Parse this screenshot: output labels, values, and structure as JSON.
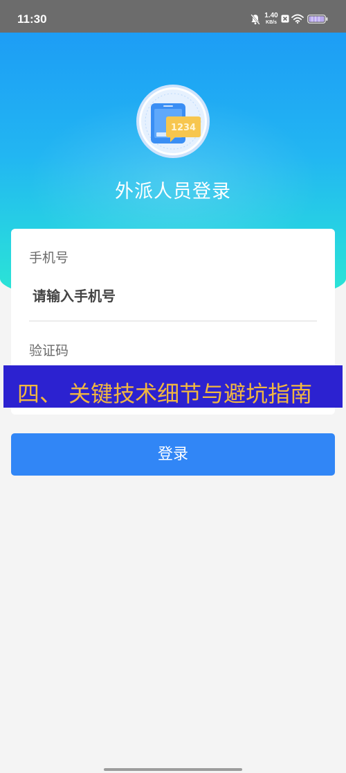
{
  "status_bar": {
    "time": "11:30",
    "network_speed_value": "1.40",
    "network_speed_unit": "KB/s",
    "icons": {
      "notifications": "bell-muted-icon",
      "sim": "sim-off-icon",
      "wifi": "wifi-icon",
      "battery": "battery-icon"
    }
  },
  "header": {
    "title": "外派人员登录",
    "logo_code": "1234",
    "logo_icon": "phone-verification-code-icon"
  },
  "form": {
    "phone": {
      "label": "手机号",
      "placeholder": "请输入手机号"
    },
    "code": {
      "label": "验证码"
    }
  },
  "banner": {
    "text": "四、 关键技术细节与避坑指南"
  },
  "login_button": {
    "label": "登录"
  },
  "colors": {
    "header_gradient_top": "#1d9df5",
    "header_gradient_bottom": "#2ce8d2",
    "primary_button": "#3186f6",
    "banner_background": "#2c22d0",
    "banner_text": "#f2b740"
  }
}
